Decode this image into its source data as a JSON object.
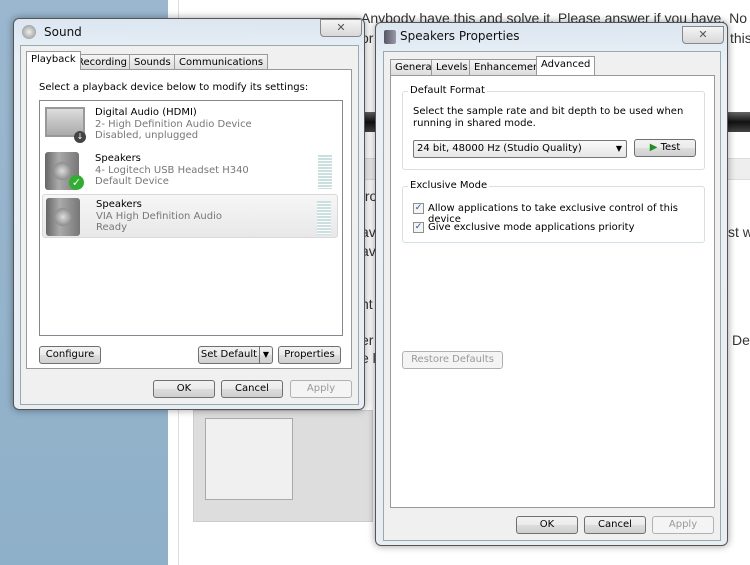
{
  "background": {
    "lines": [
      "Anybody have this and solve it. Please answer if you have. No spe",
      "or",
      "this",
      "tro",
      "st w",
      "ave",
      "av",
      "nt",
      "er",
      "e l",
      "Dev"
    ]
  },
  "sound": {
    "title": "Sound",
    "close": "✕",
    "tabs": [
      "Playback",
      "Recording",
      "Sounds",
      "Communications"
    ],
    "instruction": "Select a playback device below to modify its settings:",
    "devices": [
      {
        "name": "Digital Audio (HDMI)",
        "desc": "2- High Definition Audio Device",
        "status": "Disabled, unplugged",
        "icon": "monitor-icon"
      },
      {
        "name": "Speakers",
        "desc": "4- Logitech USB Headset H340",
        "status": "Default Device",
        "icon": "speaker-icon",
        "badge": "check-icon"
      },
      {
        "name": "Speakers",
        "desc": "VIA High Definition Audio",
        "status": "Ready",
        "icon": "speaker-icon",
        "selected": true
      }
    ],
    "configure": "Configure",
    "set_default": "Set Default",
    "properties": "Properties",
    "ok": "OK",
    "cancel": "Cancel",
    "apply": "Apply"
  },
  "props": {
    "title": "Speakers Properties",
    "close": "✕",
    "tabs": [
      "General",
      "Levels",
      "Enhancements",
      "Advanced"
    ],
    "active_tab": "Advanced",
    "default_format": {
      "label": "Default Format",
      "desc": "Select the sample rate and bit depth to be used when running in shared mode.",
      "value": "24 bit, 48000 Hz (Studio Quality)",
      "test": "Test"
    },
    "exclusive": {
      "label": "Exclusive Mode",
      "allow": "Allow applications to take exclusive control of this device",
      "allow_checked": true,
      "priority": "Give exclusive mode applications priority",
      "priority_checked": true
    },
    "restore": "Restore Defaults",
    "ok": "OK",
    "cancel": "Cancel",
    "apply": "Apply"
  },
  "colors": {
    "accent": "#1e8f1e",
    "check": "#2fae2f"
  }
}
